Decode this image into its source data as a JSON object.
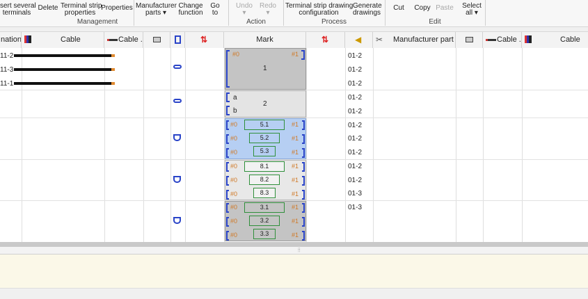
{
  "ribbon": {
    "buttons": [
      {
        "label": "sert several\nterminals",
        "enabled": true
      },
      {
        "label": "Delete",
        "enabled": true
      },
      {
        "label": "Terminal strip\nproperties",
        "enabled": true
      },
      {
        "label": "Properties",
        "enabled": true
      },
      {
        "label": "Manufacturer\nparts ▾",
        "enabled": true
      },
      {
        "label": "Change\nfunction",
        "enabled": true
      },
      {
        "label": "Go\nto",
        "enabled": true
      },
      {
        "label": "Undo\n▾",
        "enabled": false
      },
      {
        "label": "Redo\n▾",
        "enabled": false
      },
      {
        "label": "Terminal strip drawing\nconfiguration",
        "enabled": true
      },
      {
        "label": "Generate\ndrawings",
        "enabled": true
      },
      {
        "label": "Cut",
        "enabled": true
      },
      {
        "label": "Copy",
        "enabled": true
      },
      {
        "label": "Paste",
        "enabled": false
      },
      {
        "label": "Select\nall ▾",
        "enabled": true
      }
    ],
    "groups": [
      "Management",
      "Action",
      "Process",
      "Edit"
    ]
  },
  "columns": {
    "c0": "nation",
    "c1": "Cable",
    "c2": "Cable ...",
    "c9": "Mark",
    "c11": "Manufacturer part",
    "c13": "Cable ...",
    "c14": "Cable"
  },
  "rows": [
    {
      "left": "11-2",
      "cable": true,
      "mark0": "#0",
      "mark1": "#1",
      "page": "01-2"
    },
    {
      "left": "11-3",
      "cable": true,
      "page": "01-2"
    },
    {
      "left": "11-1",
      "cable": true,
      "page": "01-2"
    },
    {
      "left": "",
      "page": "01-2"
    },
    {
      "left": "",
      "page": "01-2"
    },
    {
      "left": "",
      "page": "01-2"
    },
    {
      "left": "",
      "page": "01-2"
    },
    {
      "left": "",
      "page": "01-2"
    },
    {
      "left": "",
      "page": "01-2"
    },
    {
      "left": "",
      "page": "01-2"
    },
    {
      "left": "",
      "page": "01-3"
    },
    {
      "left": "",
      "page": "01-3"
    },
    {
      "left": "",
      "page": ""
    },
    {
      "left": "",
      "page": ""
    }
  ],
  "groups": {
    "g1": {
      "label": "1",
      "p0": "#0",
      "p1": "#1"
    },
    "g2": {
      "label": "2",
      "a": "a",
      "b": "b"
    },
    "g5": [
      "5.1",
      "5.2",
      "5.3"
    ],
    "g8": [
      "8.1",
      "8.2",
      "8.3"
    ],
    "g3": [
      "3.1",
      "3.2",
      "3.3"
    ],
    "p0": "#0",
    "p1": "#1"
  },
  "colors": {
    "accent": "#2a44c8",
    "selected": "#b6cff3",
    "gray": "#c0c0c0",
    "green": "#2f8f3a",
    "orange": "#d07a28"
  }
}
